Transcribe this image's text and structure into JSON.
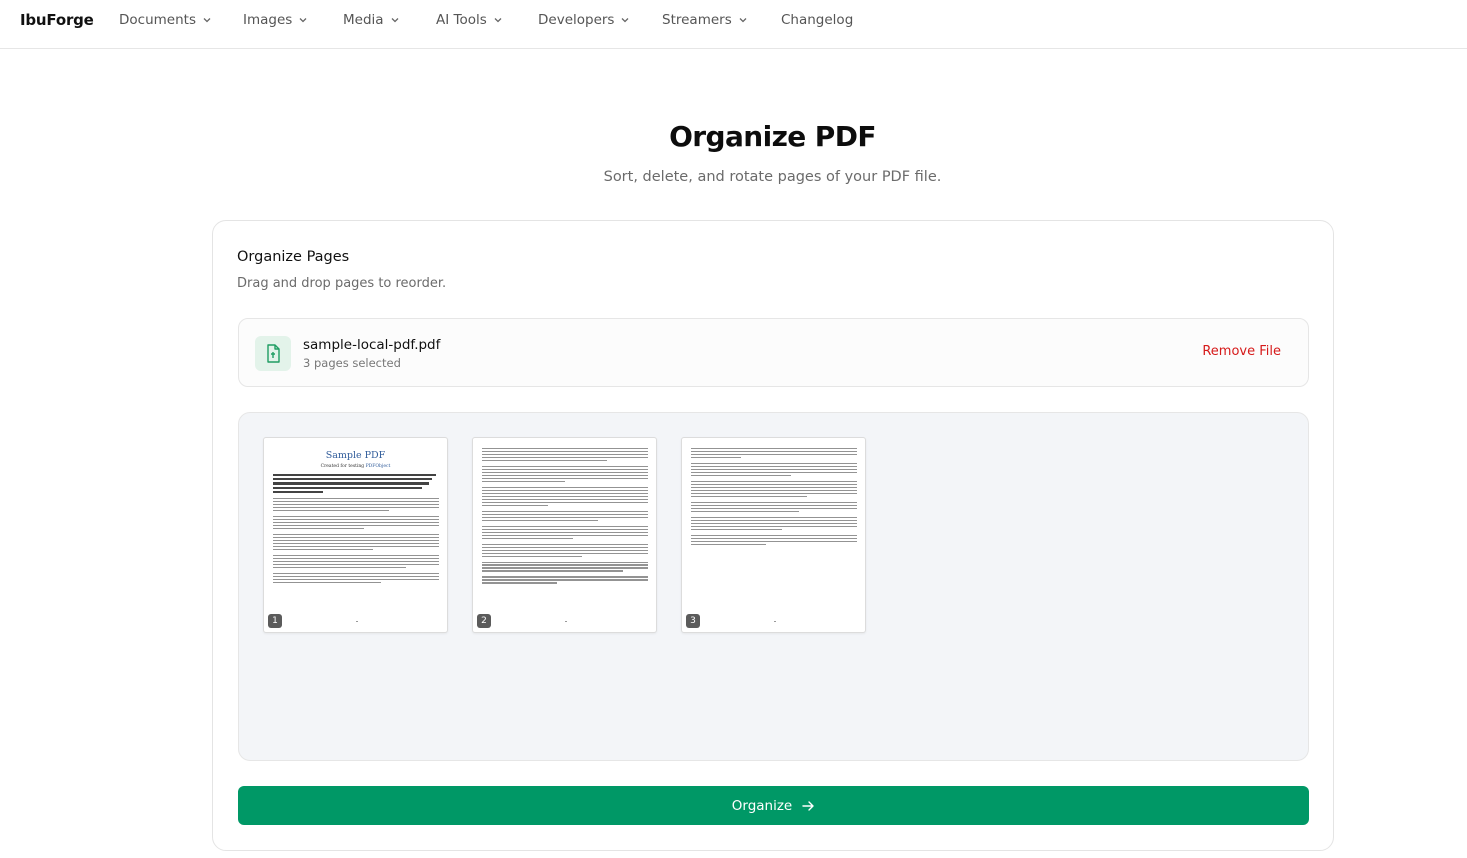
{
  "nav": {
    "brand": "IbuForge",
    "items": [
      {
        "label": "Documents"
      },
      {
        "label": "Images"
      },
      {
        "label": "Media"
      },
      {
        "label": "AI Tools"
      },
      {
        "label": "Developers"
      },
      {
        "label": "Streamers"
      },
      {
        "label": "Changelog"
      }
    ]
  },
  "header": {
    "title": "Organize PDF",
    "subtitle": "Sort, delete, and rotate pages of your PDF file."
  },
  "card": {
    "title": "Organize Pages",
    "subtitle": "Drag and drop pages to reorder."
  },
  "file": {
    "name": "sample-local-pdf.pdf",
    "meta": "3 pages selected",
    "remove_label": "Remove File",
    "icon": "file-icon"
  },
  "pages": [
    {
      "number": "1",
      "heading": "Sample PDF",
      "credit_prefix": "Created for testing ",
      "credit_link": "PDFObject"
    },
    {
      "number": "2"
    },
    {
      "number": "3"
    }
  ],
  "actions": {
    "organize_label": "Organize",
    "organize_icon": "arrow-right-icon"
  },
  "colors": {
    "accent": "#009866",
    "danger": "#d61a1a",
    "icon_bg": "#e3f3ea"
  }
}
